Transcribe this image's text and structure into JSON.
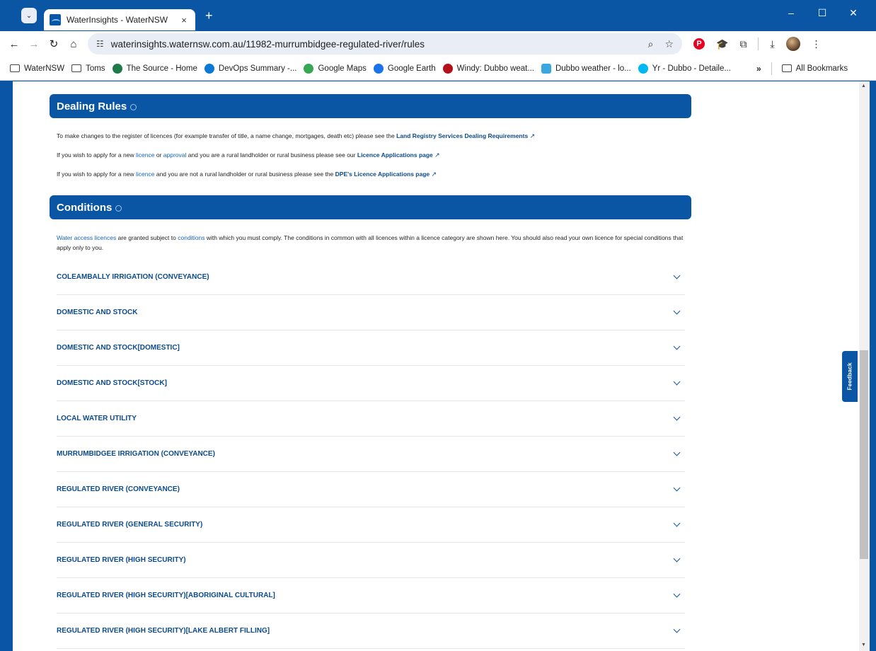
{
  "browser": {
    "tab_title": "WaterInsights - WaterNSW",
    "tab_close": "×",
    "new_tab": "+",
    "url": "waterinsights.waternsw.com.au/11982-murrumbidgee-regulated-river/rules",
    "icons": [
      "chevron-down-icon",
      "back-icon",
      "forward-icon",
      "reload-icon",
      "home-icon",
      "site-settings-icon",
      "zoom-icon",
      "star-icon",
      "pinterest-icon",
      "graduation-cap-icon",
      "extensions-icon",
      "download-icon",
      "avatar",
      "more-icon"
    ],
    "window_controls": [
      "–",
      "☐",
      "✕"
    ]
  },
  "bookmarks": {
    "items": [
      "WaterNSW",
      "Toms",
      "The Source - Home",
      "DevOps Summary -...",
      "Google Maps",
      "Google Earth",
      "Windy: Dubbo weat...",
      "Dubbo weather - lo...",
      "Yr - Dubbo - Detaile..."
    ],
    "more": "»",
    "all": "All Bookmarks"
  },
  "dealing": {
    "title": "Dealing Rules",
    "p1_text": "To make changes to the register of licences (for example transfer of title, a name change, mortgages, death etc) please see the",
    "p1_link": "Land Registry Services Dealing Requirements",
    "p2_a": "If you wish to apply for a new",
    "p2_licence": "licence",
    "p2_or": "or",
    "p2_approval": "approval",
    "p2_b": "and you are a rural landholder or rural business please see our",
    "p2_link": "Licence Applications page",
    "p3_a": "If you wish to apply for a new",
    "p3_licence": "licence",
    "p3_b": "and you are not a rural landholder or rural business please see the",
    "p3_link": "DPE's Licence Applications page"
  },
  "conditions": {
    "title": "Conditions",
    "intro_link1": "Water access licences",
    "intro_a": "are granted subject to",
    "intro_link2": "conditions",
    "intro_b": "with which you must comply. The conditions in common with all licences within a licence category are shown here. You should also read your own licence for special conditions that apply only to you.",
    "items": [
      "COLEAMBALLY IRRIGATION (CONVEYANCE)",
      "DOMESTIC AND STOCK",
      "DOMESTIC AND STOCK[DOMESTIC]",
      "DOMESTIC AND STOCK[STOCK]",
      "LOCAL WATER UTILITY",
      "MURRUMBIDGEE IRRIGATION (CONVEYANCE)",
      "REGULATED RIVER (CONVEYANCE)",
      "REGULATED RIVER (GENERAL SECURITY)",
      "REGULATED RIVER (HIGH SECURITY)",
      "REGULATED RIVER (HIGH SECURITY)[ABORIGINAL CULTURAL]",
      "REGULATED RIVER (HIGH SECURITY)[LAKE ALBERT FILLING]"
    ]
  },
  "feedback": "Feedback",
  "colors": {
    "brand": "#0b56a4",
    "link": "#1565c0"
  }
}
